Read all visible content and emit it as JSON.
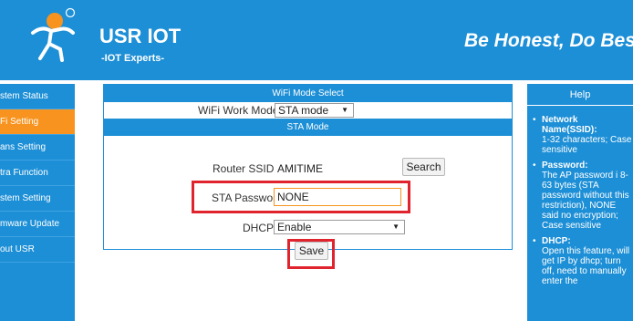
{
  "header": {
    "brand": "USR IOT",
    "subtitle": "-IOT Experts-",
    "slogan": "Be Honest, Do Best!"
  },
  "sidebar": {
    "items": [
      {
        "label": "stem Status",
        "active": false
      },
      {
        "label": "Fi Setting",
        "active": true
      },
      {
        "label": "ans Setting",
        "active": false
      },
      {
        "label": "tra Function",
        "active": false
      },
      {
        "label": "stem Setting",
        "active": false
      },
      {
        "label": "mware Update",
        "active": false
      },
      {
        "label": "out USR",
        "active": false
      }
    ]
  },
  "main": {
    "wifi_mode_section": "WiFi Mode Select",
    "work_mode_label": "WiFi Work Mode:",
    "work_mode_value": "STA mode",
    "sta_section": "STA Mode",
    "ssid_label": "Router SSID:",
    "ssid_value": "AMITIME",
    "search_button": "Search",
    "password_label": "STA Password:",
    "password_value": "NONE",
    "dhcp_label": "DHCP:",
    "dhcp_value": "Enable",
    "save_button": "Save"
  },
  "help": {
    "title": "Help",
    "items": [
      {
        "term": "Network Name(SSID):",
        "desc": "1-32 characters; Case sensitive"
      },
      {
        "term": "Password:",
        "desc": "The AP password i 8-63 bytes (STA password without this restriction), NONE said no encryption; Case sensitive"
      },
      {
        "term": "DHCP:",
        "desc": "Open this feature, will get IP by dhcp; turn off, need to manually enter the"
      }
    ]
  },
  "colors": {
    "primary": "#1d8fd6",
    "active": "#f7931e",
    "highlight": "#e0242d"
  }
}
